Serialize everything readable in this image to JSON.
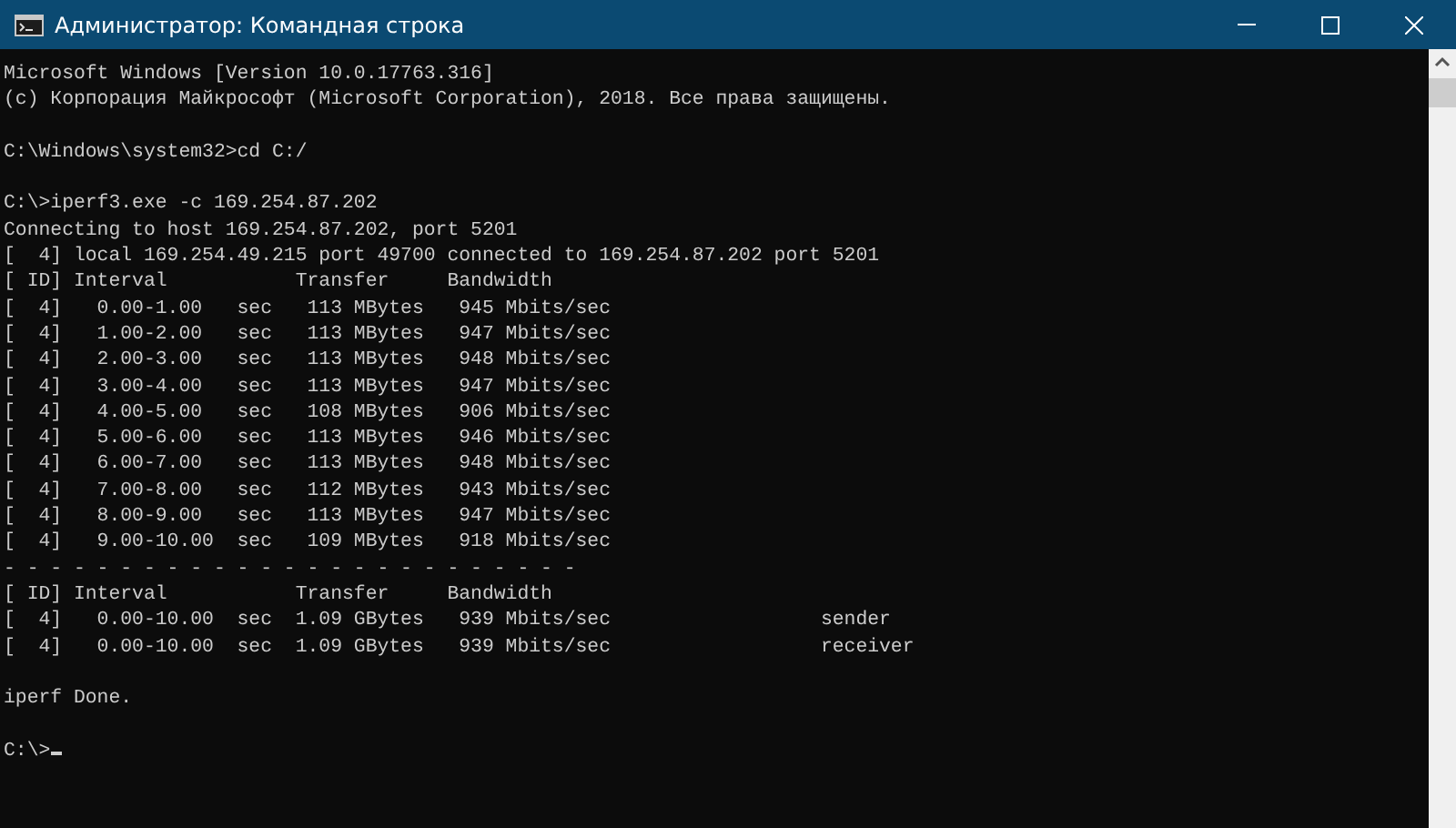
{
  "window": {
    "title": "Администратор: Командная строка"
  },
  "console": {
    "blocks": [
      [
        "Microsoft Windows [Version 10.0.17763.316]",
        "(c) Корпорация Майкрософт (Microsoft Corporation), 2018. Все права защищены."
      ],
      [
        "C:\\Windows\\system32>cd C:/"
      ],
      [
        "C:\\>iperf3.exe -c 169.254.87.202",
        "Connecting to host 169.254.87.202, port 5201",
        "[  4] local 169.254.49.215 port 49700 connected to 169.254.87.202 port 5201",
        "[ ID] Interval           Transfer     Bandwidth",
        "[  4]   0.00-1.00   sec   113 MBytes   945 Mbits/sec",
        "[  4]   1.00-2.00   sec   113 MBytes   947 Mbits/sec",
        "[  4]   2.00-3.00   sec   113 MBytes   948 Mbits/sec",
        "[  4]   3.00-4.00   sec   113 MBytes   947 Mbits/sec",
        "[  4]   4.00-5.00   sec   108 MBytes   906 Mbits/sec",
        "[  4]   5.00-6.00   sec   113 MBytes   946 Mbits/sec",
        "[  4]   6.00-7.00   sec   113 MBytes   948 Mbits/sec",
        "[  4]   7.00-8.00   sec   112 MBytes   943 Mbits/sec",
        "[  4]   8.00-9.00   sec   113 MBytes   947 Mbits/sec",
        "[  4]   9.00-10.00  sec   109 MBytes   918 Mbits/sec",
        "- - - - - - - - - - - - - - - - - - - - - - - - -",
        "[ ID] Interval           Transfer     Bandwidth",
        "[  4]   0.00-10.00  sec  1.09 GBytes   939 Mbits/sec                  sender",
        "[  4]   0.00-10.00  sec  1.09 GBytes   939 Mbits/sec                  receiver"
      ],
      [
        "iperf Done."
      ],
      [
        "C:\\>"
      ]
    ]
  }
}
